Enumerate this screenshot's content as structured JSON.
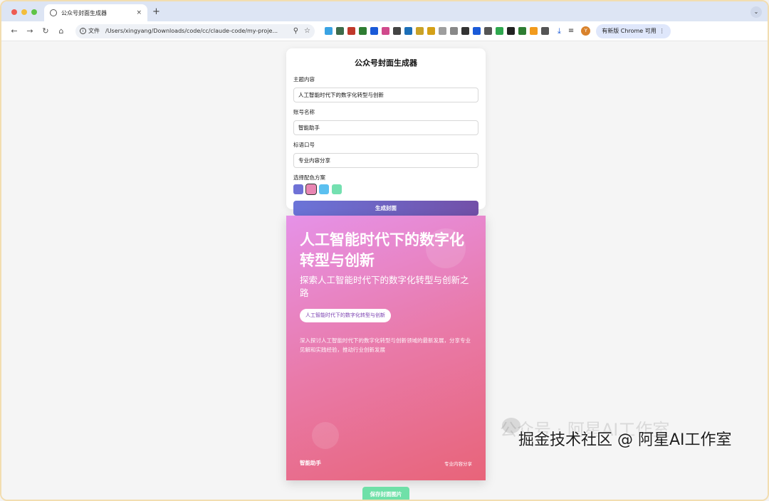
{
  "browser": {
    "tab_title": "公众号封面生成器",
    "tab_close": "×",
    "new_tab": "+",
    "tab_menu": "⌄",
    "back": "←",
    "forward": "→",
    "reload": "↻",
    "home": "⌂",
    "scheme_label": "文件",
    "url": "/Users/xingyang/Downloads/code/cc/claude-code/my-proje...",
    "zoom_icon": "⚲",
    "star_icon": "☆",
    "update_label": "有新版 Chrome 可用",
    "update_more": "⋮",
    "profile_initial": "Y",
    "extension_colors": [
      "#3aa3e3",
      "#3d6b4a",
      "#c0392b",
      "#2e7d32",
      "#1a5ad8",
      "#d04a8c",
      "#444444",
      "#1c6fb8",
      "#c9a227",
      "#d4a017",
      "#9e9e9e",
      "#888888",
      "#333333",
      "#1a5ad8",
      "#555555",
      "#2fa84f",
      "#222222",
      "#2e7d32",
      "#f29b1d",
      "#555555"
    ]
  },
  "form": {
    "title": "公众号封面生成器",
    "topic_label": "主题内容",
    "topic_value": "人工智能时代下的数字化转型与创新",
    "account_label": "账号名称",
    "account_value": "智能助手",
    "slogan_label": "标语口号",
    "slogan_value": "专业内容分享",
    "color_label": "选择配色方案",
    "color_schemes": [
      "#6f72d6",
      "#e986b3",
      "#5bc0f0",
      "#74e0b0"
    ],
    "selected_scheme": 1,
    "generate_label": "生成封面"
  },
  "cover": {
    "title": "人工智能时代下的数字化转型与创新",
    "subtitle": "探索人工智能时代下的数字化转型与创新之路",
    "pill": "人工智能时代下的数字化转型与创新",
    "description": "深入探讨人工智能时代下的数字化转型与创新领域的最新发展，分享专业见解和实践经验，推动行业创新发展",
    "account": "智能助手",
    "slogan": "专业内容分享"
  },
  "save_label": "保存封面图片",
  "watermark": {
    "line1": "公众号 · 阿星AI工作室",
    "line2": "掘金技术社区 @ 阿星AI工作室"
  }
}
